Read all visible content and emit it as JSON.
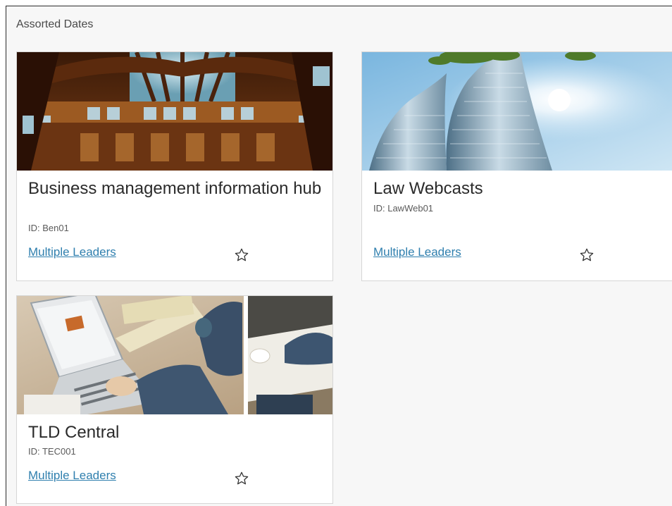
{
  "section": {
    "title": "Assorted Dates"
  },
  "cards": [
    {
      "title": "Business management information hub",
      "id_text": "ID: Ben01",
      "link_label": "Multiple Leaders",
      "icon": "star-outline-icon",
      "image": "ornate-wooden-dome-ceiling"
    },
    {
      "title": "Law Webcasts",
      "id_text": "ID: LawWeb01",
      "link_label": "Multiple Leaders",
      "icon": "star-outline-icon",
      "image": "glass-towers-sky-sun"
    },
    {
      "title": "TLD Central",
      "id_text": "ID: TEC001",
      "link_label": "Multiple Leaders",
      "icon": "star-outline-icon",
      "image": "laptop-desk-collage"
    }
  ],
  "colors": {
    "link": "#2f7fae",
    "background": "#f7f7f7",
    "card_border": "#d6d6d6"
  }
}
